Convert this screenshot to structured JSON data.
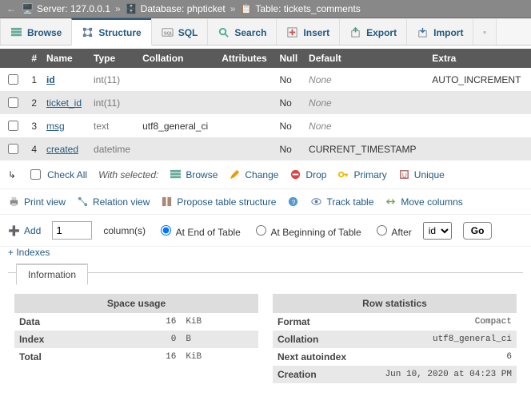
{
  "breadcrumb": {
    "server_label": "Server:",
    "server_value": "127.0.0.1",
    "db_label": "Database:",
    "db_value": "phpticket",
    "table_label": "Table:",
    "table_value": "tickets_comments"
  },
  "tabs": {
    "browse": "Browse",
    "structure": "Structure",
    "sql": "SQL",
    "search": "Search",
    "insert": "Insert",
    "export": "Export",
    "import": "Import"
  },
  "headers": {
    "num": "#",
    "name": "Name",
    "type": "Type",
    "collation": "Collation",
    "attributes": "Attributes",
    "null": "Null",
    "default": "Default",
    "extra": "Extra"
  },
  "rows": [
    {
      "n": "1",
      "name": "id",
      "pk": true,
      "type": "int(11)",
      "coll": "",
      "attr": "",
      "null": "No",
      "def": "None",
      "def_dim": true,
      "extra": "AUTO_INCREMENT"
    },
    {
      "n": "2",
      "name": "ticket_id",
      "pk": false,
      "type": "int(11)",
      "coll": "",
      "attr": "",
      "null": "No",
      "def": "None",
      "def_dim": true,
      "extra": ""
    },
    {
      "n": "3",
      "name": "msg",
      "pk": false,
      "type": "text",
      "coll": "utf8_general_ci",
      "attr": "",
      "null": "No",
      "def": "None",
      "def_dim": true,
      "extra": ""
    },
    {
      "n": "4",
      "name": "created",
      "pk": false,
      "type": "datetime",
      "coll": "",
      "attr": "",
      "null": "No",
      "def": "CURRENT_TIMESTAMP",
      "def_dim": false,
      "extra": ""
    }
  ],
  "actionbar": {
    "check_all": "Check All",
    "with_selected": "With selected:",
    "browse": "Browse",
    "change": "Change",
    "drop": "Drop",
    "primary": "Primary",
    "unique": "Unique"
  },
  "toolbar2": {
    "print": "Print view",
    "relation": "Relation view",
    "propose": "Propose table structure",
    "track": "Track table",
    "move": "Move columns"
  },
  "addrow": {
    "add": "Add",
    "count": "1",
    "cols_label": "column(s)",
    "opt_end": "At End of Table",
    "opt_begin": "At Beginning of Table",
    "opt_after": "After",
    "after_field": "id",
    "go": "Go"
  },
  "indexes_link": "+ Indexes",
  "info_title": "Information",
  "space": {
    "title": "Space usage",
    "rows": [
      {
        "k": "Data",
        "v": "16",
        "u": "KiB"
      },
      {
        "k": "Index",
        "v": "0",
        "u": "B"
      },
      {
        "k": "Total",
        "v": "16",
        "u": "KiB"
      }
    ]
  },
  "stats": {
    "title": "Row statistics",
    "rows": [
      {
        "k": "Format",
        "v": "Compact"
      },
      {
        "k": "Collation",
        "v": "utf8_general_ci"
      },
      {
        "k": "Next autoindex",
        "v": "6"
      },
      {
        "k": "Creation",
        "v": "Jun 10, 2020 at 04:23 PM"
      }
    ]
  }
}
